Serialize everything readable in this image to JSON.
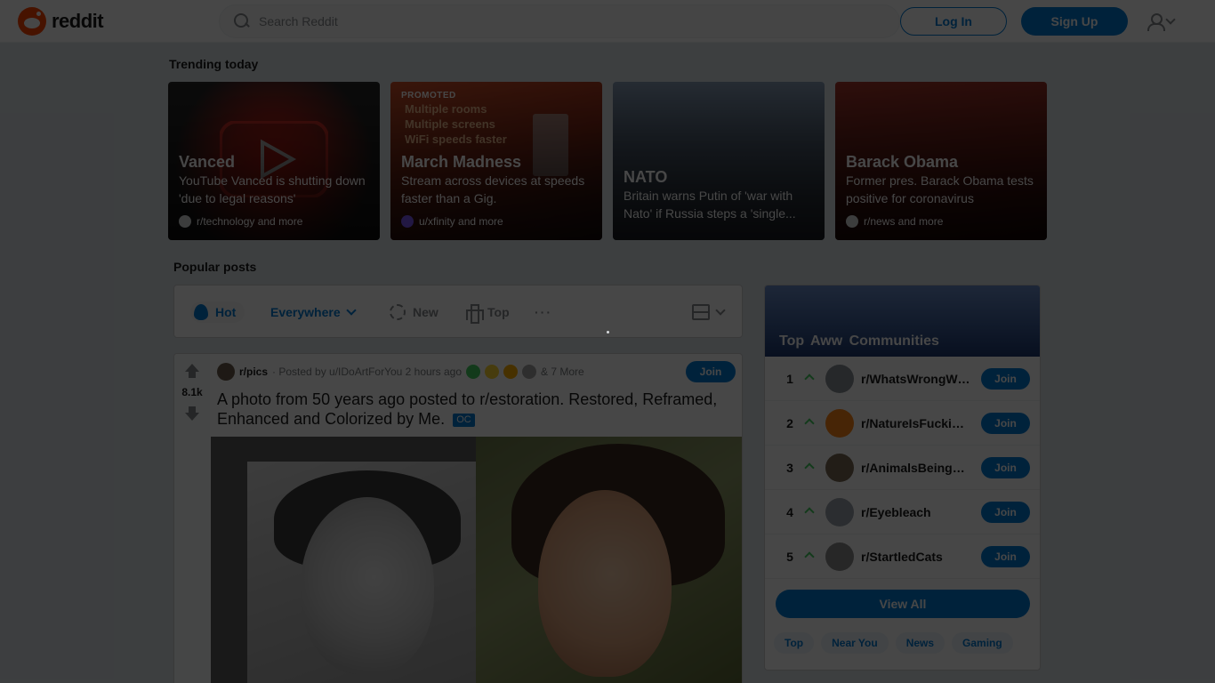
{
  "header": {
    "logo_text": "reddit",
    "search_placeholder": "Search Reddit",
    "login_label": "Log In",
    "signup_label": "Sign Up"
  },
  "trending": {
    "title": "Trending today",
    "cards": [
      {
        "title": "Vanced",
        "desc": "YouTube Vanced is shutting down 'due to legal reasons'",
        "sub": "r/technology and more",
        "bg": "#b3261e"
      },
      {
        "title": "March Madness",
        "desc": "Stream across devices at speeds faster than a Gig.",
        "sub": "u/xfinity and more",
        "promoted": "PROMOTED",
        "promo_lines": [
          "Multiple rooms",
          "Multiple screens",
          "WiFi speeds faster"
        ],
        "bg": "#c1441f"
      },
      {
        "title": "NATO",
        "desc": "Britain warns Putin of 'war with Nato' if Russia steps a 'single...",
        "sub": "",
        "bg": "#5b6b82"
      },
      {
        "title": "Barack Obama",
        "desc": "Former pres. Barack Obama tests positive for coronavirus",
        "sub": "r/news and more",
        "bg": "#8a2b22"
      }
    ]
  },
  "popular": {
    "title": "Popular posts",
    "sort": {
      "hot": "Hot",
      "everywhere": "Everywhere",
      "new": "New",
      "top": "Top",
      "more": "···"
    }
  },
  "post": {
    "votes": "8.1k",
    "subreddit": "r/pics",
    "posted_by": "· Posted by u/IDoArtForYou 2 hours ago",
    "more_awards": "& 7 More",
    "join_label": "Join",
    "title": "A photo from 50 years ago posted to r/estoration. Restored, Reframed, Enhanced and Colorized by Me.",
    "flair": "OC"
  },
  "communities": {
    "title": "Top  Aww  Communities",
    "items": [
      {
        "rank": "1",
        "name": "r/WhatsWrongWithYourDog",
        "join": "Join",
        "color": "#8a8f96"
      },
      {
        "rank": "2",
        "name": "r/NatureIsFuckingLit",
        "join": "Join",
        "color": "#ff8717"
      },
      {
        "rank": "3",
        "name": "r/AnimalsBeingBros",
        "join": "Join",
        "color": "#7a6a55"
      },
      {
        "rank": "4",
        "name": "r/Eyebleach",
        "join": "Join",
        "color": "#9aa3ab"
      },
      {
        "rank": "5",
        "name": "r/StartledCats",
        "join": "Join",
        "color": "#8c8c8c"
      }
    ],
    "view_all": "View All",
    "tabs": [
      "Top",
      "Near You",
      "News",
      "Gaming"
    ]
  }
}
